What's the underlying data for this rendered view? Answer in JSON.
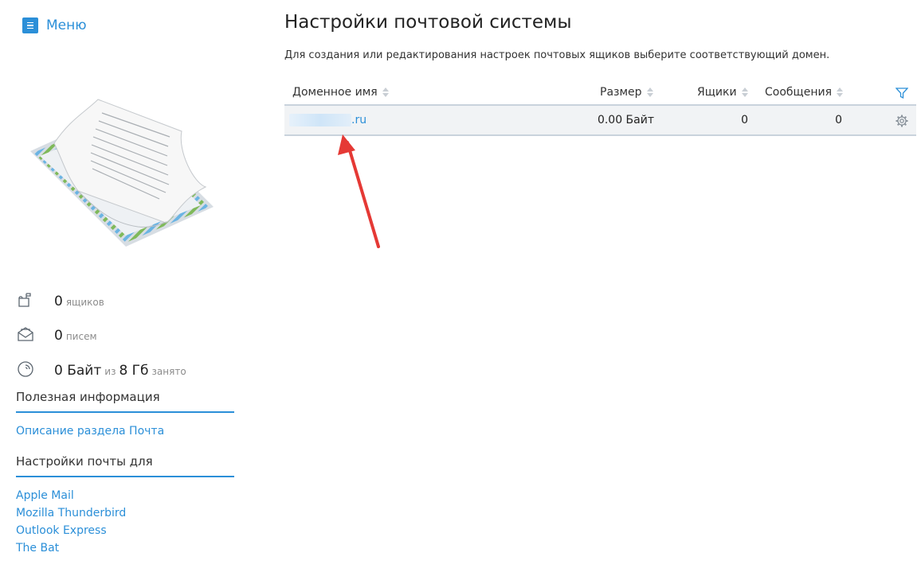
{
  "sidebar": {
    "menu_label": "Меню",
    "stats": {
      "mailboxes_value": "0",
      "mailboxes_unit": "ящиков",
      "letters_value": "0",
      "letters_unit": "писем",
      "storage_used": "0 Байт",
      "storage_of": "из",
      "storage_total": "8 Гб",
      "storage_suffix": "занято"
    },
    "useful_info": {
      "title": "Полезная информация",
      "links": [
        "Описание раздела Почта"
      ]
    },
    "mail_settings": {
      "title": "Настройки почты для",
      "links": [
        "Apple Mail",
        "Mozilla Thunderbird",
        "Outlook Express",
        "The Bat"
      ]
    }
  },
  "main": {
    "title": "Настройки почтовой системы",
    "description": "Для создания или редактирования настроек почтовых ящиков выберите соответствующий домен.",
    "table": {
      "columns": {
        "domain": "Доменное имя",
        "size": "Размер",
        "mailboxes": "Ящики",
        "messages": "Сообщения"
      },
      "rows": [
        {
          "domain_suffix": ".ru",
          "size": "0.00 Байт",
          "mailboxes": "0",
          "messages": "0"
        }
      ]
    }
  },
  "colors": {
    "accent": "#2b8fd8",
    "annotation_arrow": "#e53935",
    "row_background": "#f1f3f5"
  }
}
